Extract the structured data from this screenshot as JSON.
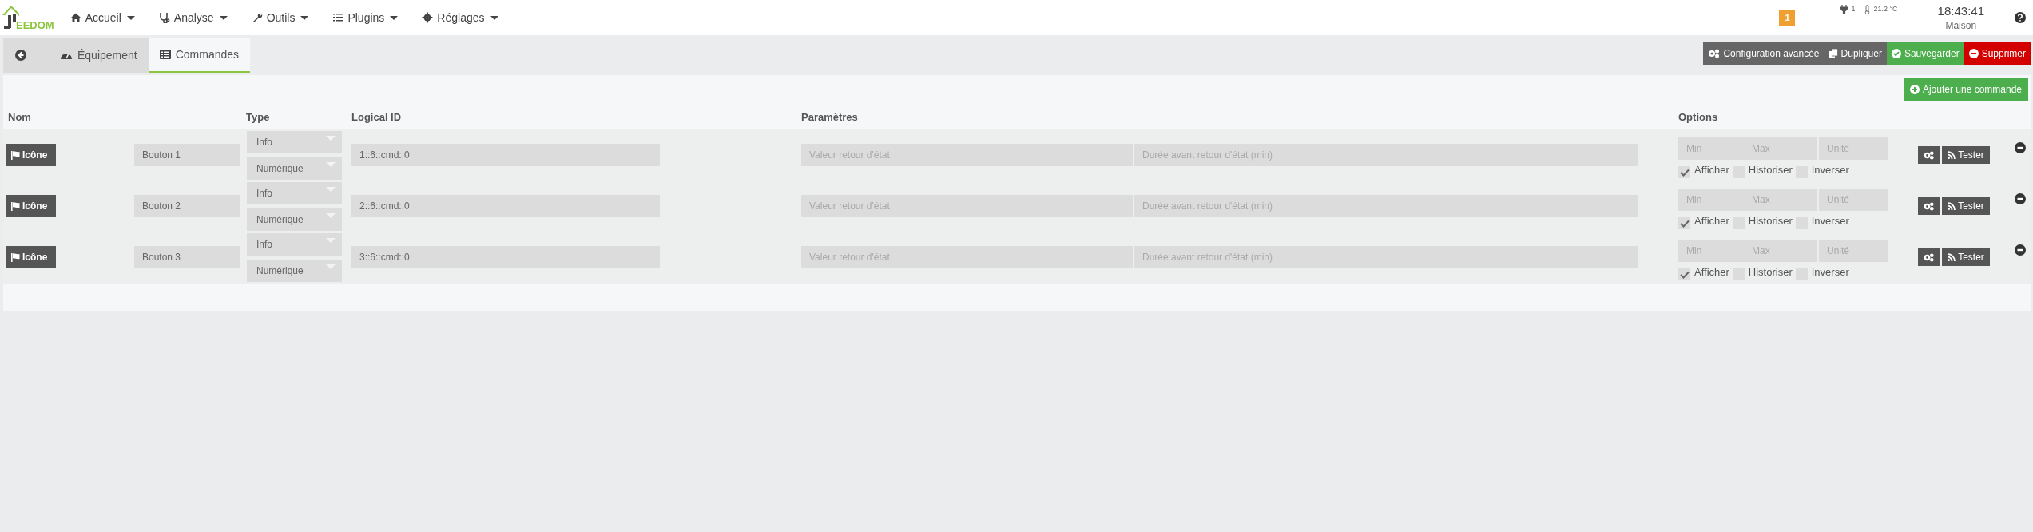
{
  "navbar": {
    "logo_text": "EEDOM",
    "items": [
      {
        "label": "Accueil"
      },
      {
        "label": "Analyse"
      },
      {
        "label": "Outils"
      },
      {
        "label": "Plugins"
      },
      {
        "label": "Réglages"
      }
    ],
    "alert_badge": "1",
    "plug_count": "1",
    "temperature": "21.2 °C",
    "time": "18:43:41",
    "location": "Maison"
  },
  "tabs": [
    {
      "kind": "back",
      "selected": false
    },
    {
      "kind": "tab",
      "label": "Équipement",
      "selected": false
    },
    {
      "kind": "tab",
      "label": "Commandes",
      "selected": true
    }
  ],
  "actions": [
    {
      "label": "Configuration avancée",
      "kind": "dark"
    },
    {
      "label": "Dupliquer",
      "kind": "dark"
    },
    {
      "label": "Sauvegarder",
      "kind": "success"
    },
    {
      "label": "Supprimer",
      "kind": "danger"
    }
  ],
  "add_button": "Ajouter une commande",
  "table": {
    "columns": [
      "Nom",
      "Type",
      "Logical ID",
      "Paramètres",
      "Options"
    ],
    "rows": [
      {
        "icon_button": "Icône",
        "name": "Bouton 1",
        "type": "Info",
        "subtype": "Numérique",
        "logical_id": "1::6::cmd::0",
        "param_placeholders": [
          "Valeur retour d'état",
          "Durée avant retour d'état (min)"
        ],
        "option_placeholders": [
          "Min",
          "Max",
          "Unité"
        ],
        "options": [
          {
            "label": "Afficher",
            "checked": true
          },
          {
            "label": "Historiser",
            "checked": false
          },
          {
            "label": "Inverser",
            "checked": false
          }
        ],
        "test_button": "Tester"
      },
      {
        "icon_button": "Icône",
        "name": "Bouton 2",
        "type": "Info",
        "subtype": "Numérique",
        "logical_id": "2::6::cmd::0",
        "param_placeholders": [
          "Valeur retour d'état",
          "Durée avant retour d'état (min)"
        ],
        "option_placeholders": [
          "Min",
          "Max",
          "Unité"
        ],
        "options": [
          {
            "label": "Afficher",
            "checked": true
          },
          {
            "label": "Historiser",
            "checked": false
          },
          {
            "label": "Inverser",
            "checked": false
          }
        ],
        "test_button": "Tester"
      },
      {
        "icon_button": "Icône",
        "name": "Bouton 3",
        "type": "Info",
        "subtype": "Numérique",
        "logical_id": "3::6::cmd::0",
        "param_placeholders": [
          "Valeur retour d'état",
          "Durée avant retour d'état (min)"
        ],
        "option_placeholders": [
          "Min",
          "Max",
          "Unité"
        ],
        "options": [
          {
            "label": "Afficher",
            "checked": true
          },
          {
            "label": "Historiser",
            "checked": false
          },
          {
            "label": "Inverser",
            "checked": false
          }
        ],
        "test_button": "Tester"
      }
    ]
  }
}
